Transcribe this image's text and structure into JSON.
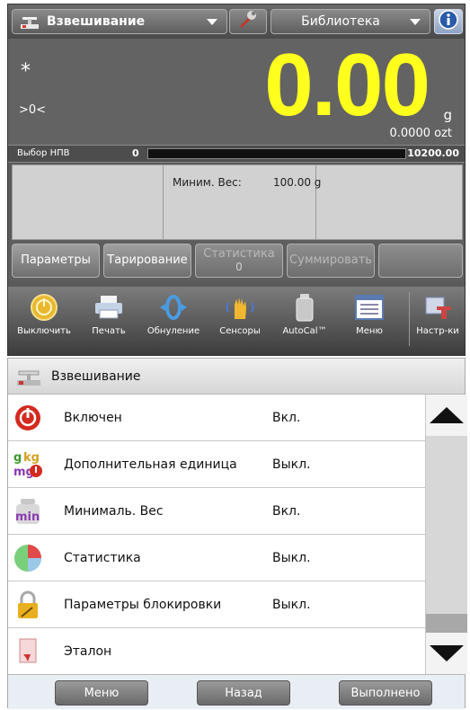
{
  "topbar": {
    "app_name": "Взвешивание",
    "library_label": "Библиотека"
  },
  "weighing": {
    "stable_indicator": "*",
    "zero_indicator": ">0<",
    "value": "0.00",
    "unit": "g",
    "secondary_value": "0.0000 ozt"
  },
  "capacity": {
    "label": "Выбор НПВ",
    "min": "0",
    "max": "10200.00"
  },
  "reference": {
    "min_weight_label": "Миним. Вес:",
    "min_weight_value": "100.00 g"
  },
  "softkeys": {
    "params": "Параметры",
    "tare": "Тарирование",
    "statistics": "Статистика",
    "statistics_count": "0",
    "accumulate": "Суммировать"
  },
  "iconbar": {
    "off": "Выключить",
    "print": "Печать",
    "zero": "Обнуление",
    "sensors": "Сенсоры",
    "autocal": "AutoCal™",
    "menu": "Меню",
    "settings": "Настр-ки"
  },
  "menu": {
    "title": "Взвешивание",
    "items": [
      {
        "label": "Включен",
        "value": "Вкл.",
        "icon": "power-icon"
      },
      {
        "label": "Дополнительная единица",
        "value": "Выкл.",
        "icon": "units-icon"
      },
      {
        "label": "Минималь. Вес",
        "value": "Вкл.",
        "icon": "min-weight-icon"
      },
      {
        "label": "Статистика",
        "value": "Выкл.",
        "icon": "statistics-icon"
      },
      {
        "label": "Параметры блокировки",
        "value": "Выкл.",
        "icon": "lock-icon"
      },
      {
        "label": "Эталон",
        "value": "",
        "icon": "reference-icon"
      }
    ],
    "footer": {
      "menu": "Меню",
      "back": "Назад",
      "done": "Выполнено"
    }
  },
  "colors": {
    "weight_display": "#ffff1e",
    "device_background": "#636363"
  }
}
